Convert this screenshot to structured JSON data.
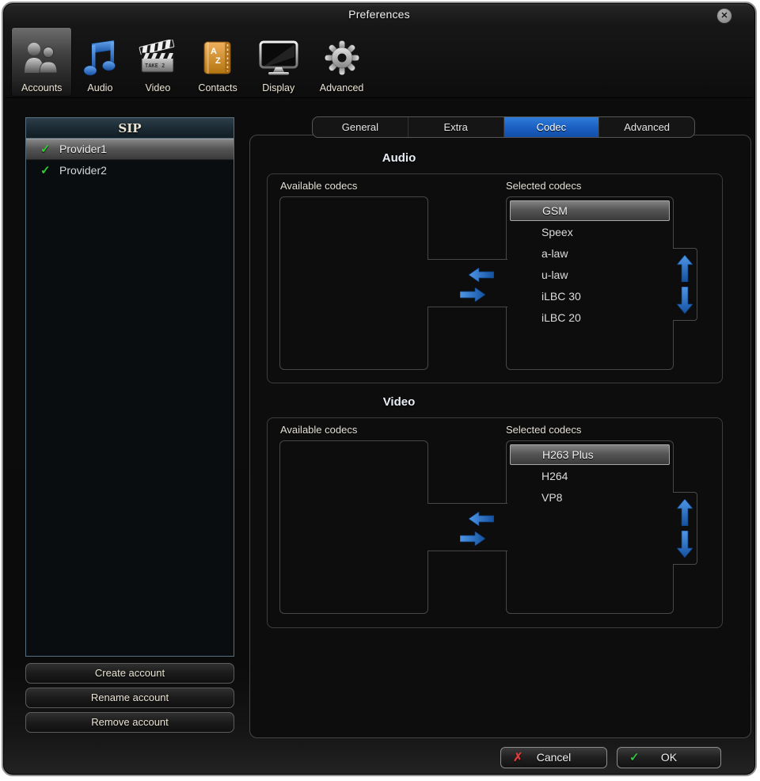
{
  "window": {
    "title": "Preferences"
  },
  "icons": {
    "close": "✕",
    "check": "✓",
    "cross": "✗"
  },
  "toolbar": {
    "items": [
      {
        "label": "Accounts",
        "icon": "people-icon",
        "selected": true
      },
      {
        "label": "Audio",
        "icon": "music-note-icon",
        "selected": false
      },
      {
        "label": "Video",
        "icon": "clapperboard-icon",
        "selected": false
      },
      {
        "label": "Contacts",
        "icon": "address-book-icon",
        "selected": false
      },
      {
        "label": "Display",
        "icon": "monitor-icon",
        "selected": false
      },
      {
        "label": "Advanced",
        "icon": "gear-icon",
        "selected": false
      }
    ]
  },
  "sidebar": {
    "header": "SIP",
    "accounts": [
      {
        "name": "Provider1",
        "status_icon": "green-check",
        "selected": true
      },
      {
        "name": "Provider2",
        "status_icon": "green-check",
        "selected": false
      }
    ],
    "buttons": {
      "create": "Create account",
      "rename": "Rename account",
      "remove": "Remove account"
    }
  },
  "tabs": {
    "items": [
      "General",
      "Extra",
      "Codec",
      "Advanced"
    ],
    "active": "Codec"
  },
  "codec_page": {
    "audio": {
      "title": "Audio",
      "available_label": "Available codecs",
      "selected_label": "Selected codecs",
      "available_codecs": [],
      "selected_codecs": [
        "GSM",
        "Speex",
        "a-law",
        "u-law",
        "iLBC 30",
        "iLBC 20"
      ],
      "highlighted": "GSM"
    },
    "video": {
      "title": "Video",
      "available_label": "Available codecs",
      "selected_label": "Selected codecs",
      "available_codecs": [],
      "selected_codecs": [
        "H263 Plus",
        "H264",
        "VP8"
      ],
      "highlighted": "H263 Plus"
    }
  },
  "footer": {
    "cancel_label": "Cancel",
    "ok_label": "OK"
  },
  "colors": {
    "active_tab_blue": "#1e63c6",
    "arrow_blue": "#2a6fc4",
    "check_green": "#33cc33",
    "cancel_red": "#d93a3a",
    "selection_gray": "#6e6e6e",
    "sidebar_border": "#56707f"
  }
}
